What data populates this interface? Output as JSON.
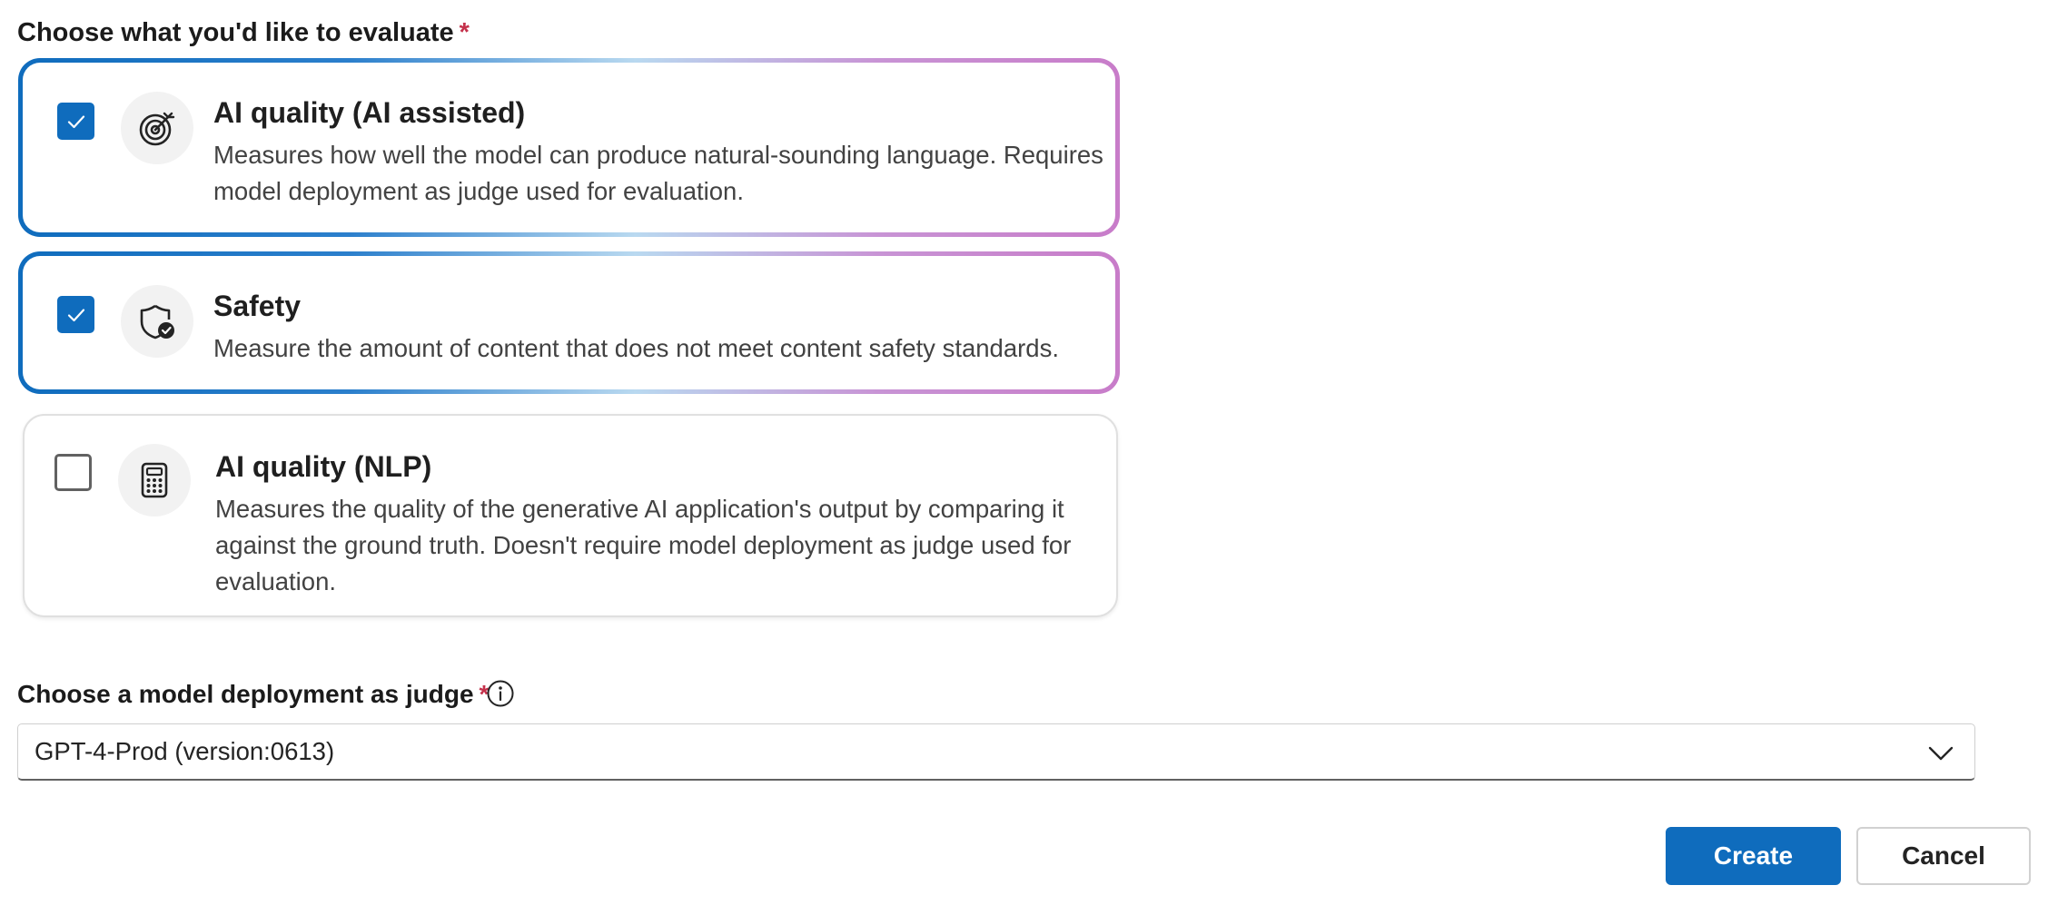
{
  "evaluate_section": {
    "label": "Choose what you'd like to evaluate",
    "required_mark": "*"
  },
  "options": [
    {
      "title": "AI quality (AI assisted)",
      "description": "Measures how well the model can produce natural-sounding language. Requires model deployment as judge used for evaluation.",
      "checked": true,
      "icon": "target-sparkle-icon"
    },
    {
      "title": "Safety",
      "description": "Measure the amount of content that does not meet content safety standards.",
      "checked": true,
      "icon": "shield-check-icon"
    },
    {
      "title": "AI quality (NLP)",
      "description": "Measures the quality of the generative AI application's output by comparing it against the ground truth. Doesn't require model deployment as judge used for evaluation.",
      "checked": false,
      "icon": "calculator-icon"
    }
  ],
  "judge_section": {
    "label": "Choose a model deployment as judge",
    "required_mark": "*",
    "info_icon": "info-icon",
    "selected_value": "GPT-4-Prod (version:0613)"
  },
  "actions": {
    "create_label": "Create",
    "cancel_label": "Cancel"
  },
  "colors": {
    "accent": "#0f6cbd",
    "required": "#c4314b",
    "gradient_end": "#c87cc9"
  }
}
